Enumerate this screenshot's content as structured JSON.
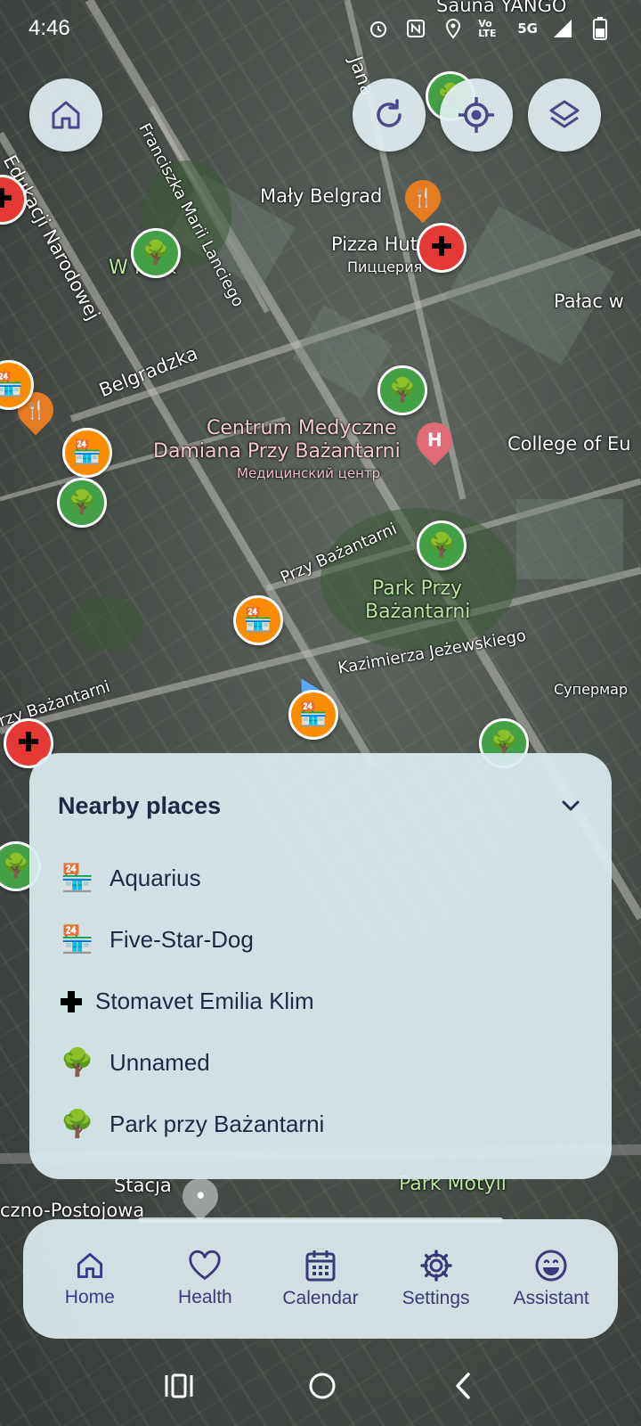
{
  "status_bar": {
    "time": "4:46",
    "network": "5G",
    "volte": "Vo LTE"
  },
  "map": {
    "labels": {
      "sauna": "Sauna YANGO",
      "edukacji": "Edukacji Narodowej",
      "franciszka": "Franciszka Marii Lanciego",
      "maly_belgrad": "Mały Belgrad",
      "pizza_hut": "Pizza Hut",
      "pizza_ru": "Пиццерия",
      "palac": "Pałac w",
      "belgradzka": "Belgradzka",
      "park_w": "W   Park",
      "centrum1": "Centrum Medyczne",
      "centrum2": "Damiana Przy Bażantarni",
      "centrum_ru": "Медицинский центр",
      "college": "College of Eu",
      "przy_bazantarni": "Przy Bażantarni",
      "park_przy1": "Park Przy",
      "park_przy2": "Bażantarni",
      "kazimierza": "Kazimierza Jeżewskiego",
      "supermarket": "Супермар",
      "bazantarni_left": "rzy Bażantarni",
      "stacja": "Stacja",
      "postojowa": "czno-Postojowa",
      "park_motyli": "Park Motyli",
      "jana": "Jana"
    }
  },
  "buttons": {
    "home": "home-icon",
    "refresh": "refresh-icon",
    "locate": "locate-icon",
    "layers": "layers-icon"
  },
  "nearby": {
    "title": "Nearby places",
    "items": [
      {
        "icon": "convenience-store-icon",
        "name": "Aquarius"
      },
      {
        "icon": "convenience-store-icon",
        "name": "Five-Star-Dog"
      },
      {
        "icon": "medical-cross-icon",
        "name": "Stomavet Emilia Klim"
      },
      {
        "icon": "tree-icon",
        "name": "Unnamed"
      },
      {
        "icon": "tree-icon",
        "name": "Park przy Bażantarni"
      }
    ]
  },
  "nav": {
    "items": [
      {
        "label": "Home",
        "icon": "home-icon",
        "active": true
      },
      {
        "label": "Health",
        "icon": "heart-icon"
      },
      {
        "label": "Calendar",
        "icon": "calendar-icon"
      },
      {
        "label": "Settings",
        "icon": "gear-icon"
      },
      {
        "label": "Assistant",
        "icon": "smiley-icon"
      }
    ]
  },
  "colors": {
    "accent": "#3a3a90",
    "panel": "#dcecf0",
    "marker_green": "#43a047",
    "marker_red": "#e53935",
    "marker_orange": "#fb8c00"
  }
}
